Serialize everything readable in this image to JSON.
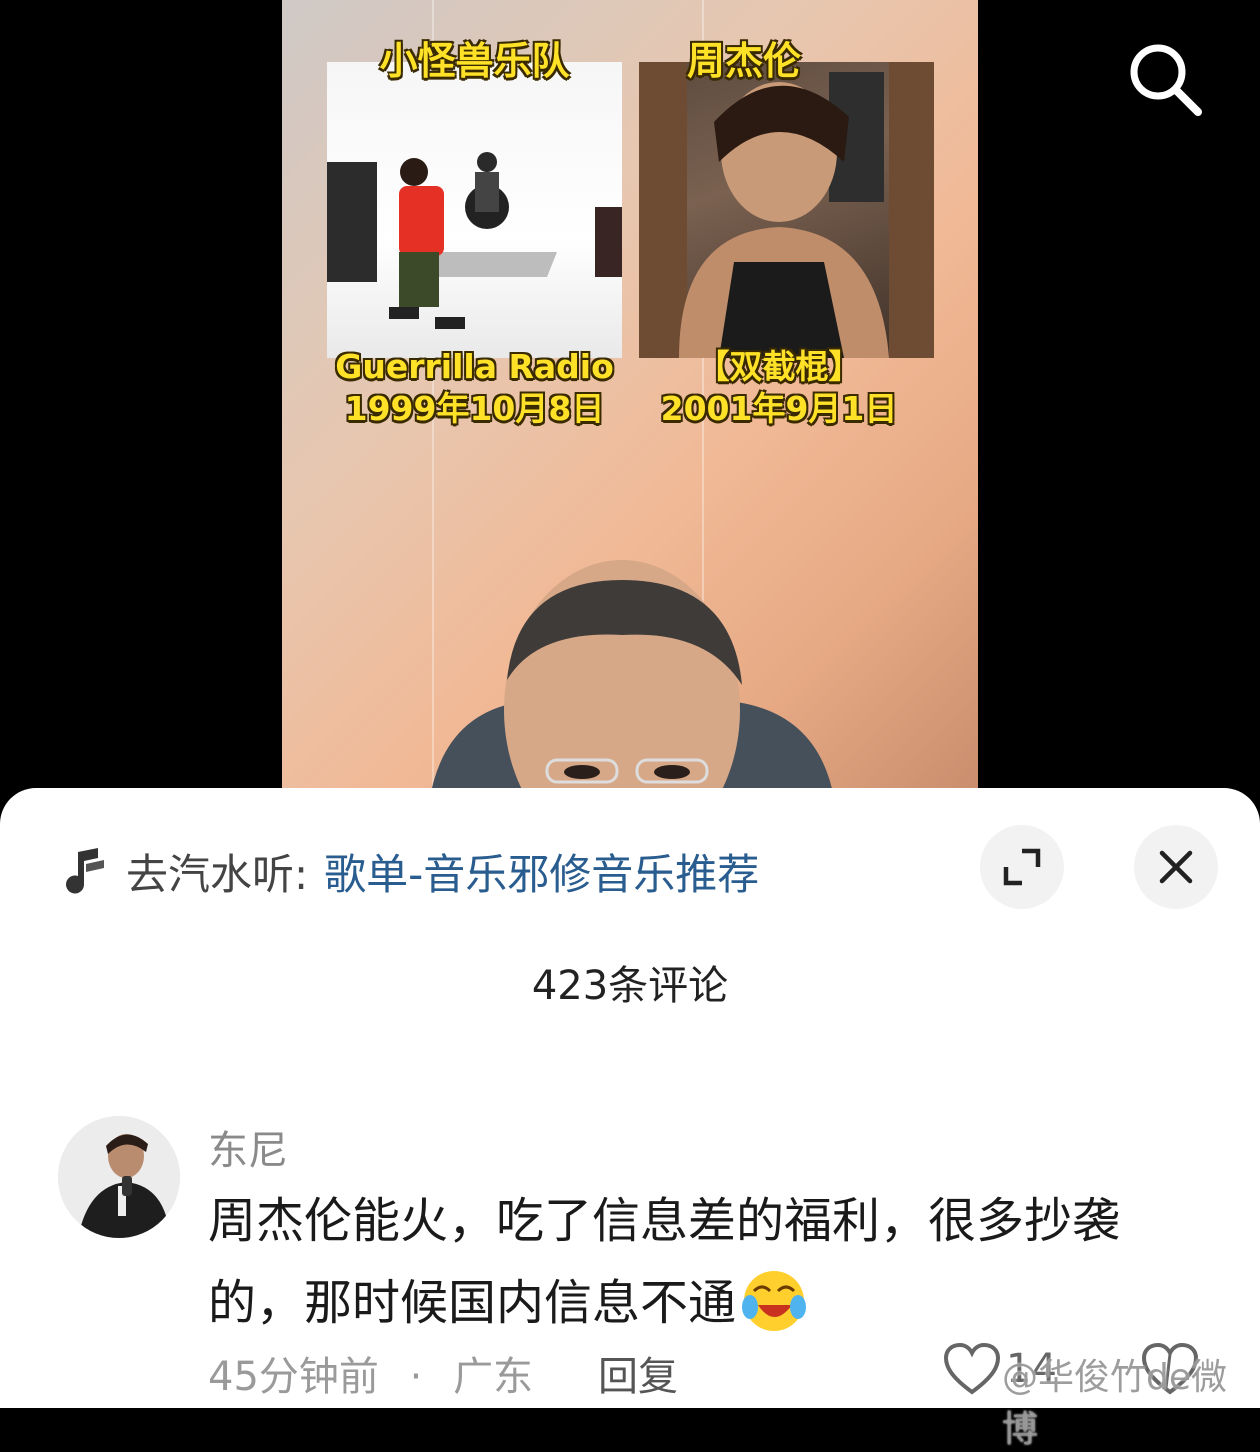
{
  "video": {
    "left_title": "小怪兽乐队",
    "right_title": "周杰伦",
    "left_caption": [
      "Guerrilla Radio",
      "1999年10月8日"
    ],
    "right_caption": [
      "【双截棍】",
      "2001年9月1日"
    ]
  },
  "music_bar": {
    "prefix": "去汽水听:",
    "link": "歌单-音乐邪修音乐推荐"
  },
  "comments_header": {
    "count_label": "423条评论"
  },
  "comment": {
    "username": "东尼",
    "text": "周杰伦能火，吃了信息差的福利，很多抄袭的，那时候国内信息不通",
    "time": "45分钟前",
    "separator": "·",
    "location": "广东",
    "reply_label": "回复",
    "like_count": "14"
  },
  "watermark": "@华俊竹de微博",
  "colors": {
    "caption_yellow": "#ffe227",
    "link_blue": "#2a5d8f",
    "sheet_bg": "#ffffff"
  },
  "icons": [
    "search-icon",
    "music-note-icon",
    "expand-icon",
    "close-icon",
    "laughing-emoji-icon",
    "heart-icon",
    "dislike-icon"
  ]
}
